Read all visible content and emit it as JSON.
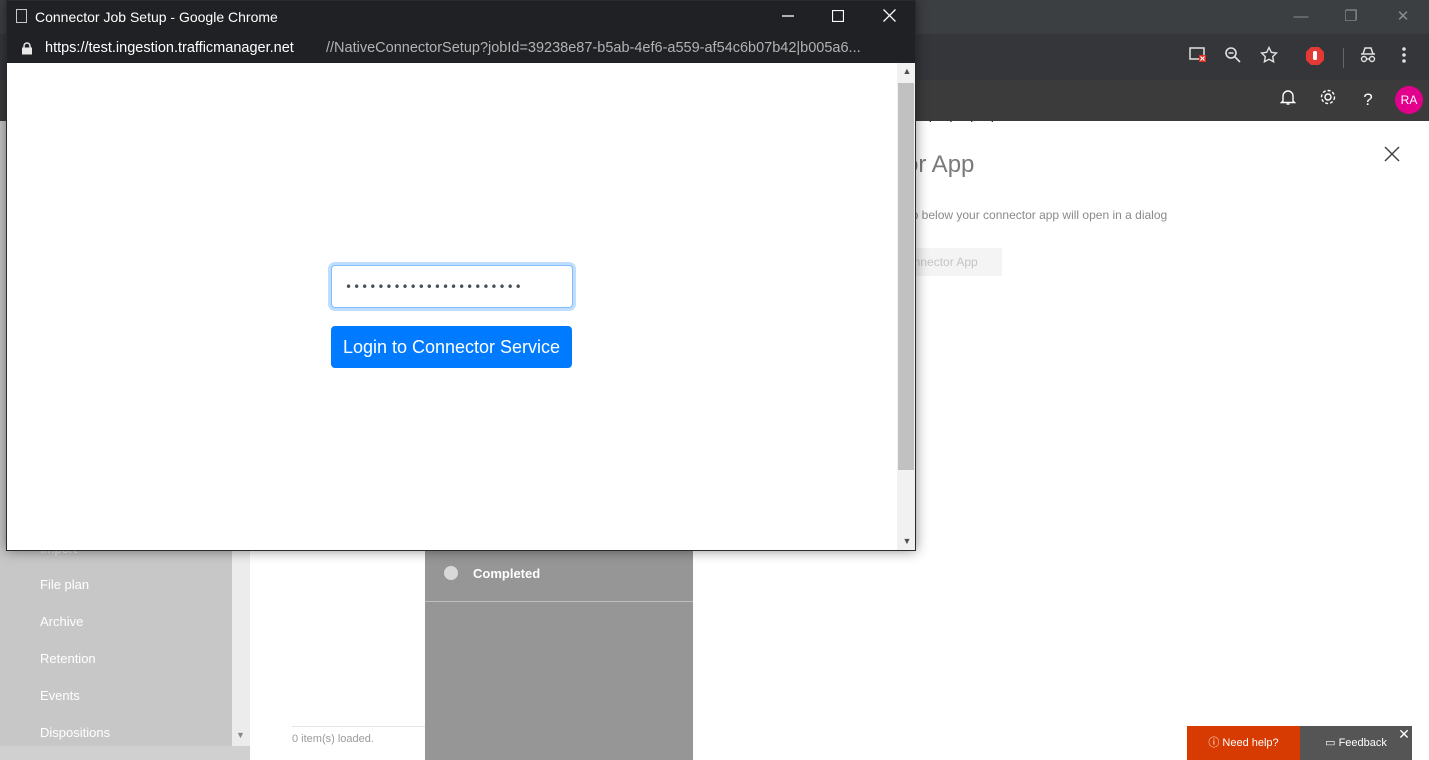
{
  "background": {
    "window_controls": [
      "—",
      "❐",
      "✕"
    ],
    "toolbar_icons": [
      "cast-blocked-icon",
      "zoom-icon",
      "star-icon",
      "adblock-icon",
      "incognito-icon",
      "menu-icon"
    ],
    "app_icons": [
      "bell-icon",
      "gear-icon",
      "help-icon"
    ],
    "avatar_initials": "RA",
    "left_nav": {
      "partial_item": "Import",
      "items": [
        "File plan",
        "Archive",
        "Retention",
        "Events",
        "Dispositions"
      ]
    },
    "list_footer": "0 item(s) loaded.",
    "steps": {
      "completed_label": "Completed"
    },
    "main": {
      "heading": "or App",
      "description": "op below your connector app will open in a dialog",
      "button_label": "onnector App"
    },
    "help_label": "Need help?",
    "feedback_label": "Feedback"
  },
  "popup": {
    "title": "Connector Job Setup - Google Chrome",
    "url_host": "https://test.ingestion.trafficmanager.net",
    "url_path": "//NativeConnectorSetup?jobId=39238e87-b5ab-4ef6-a559-af54c6b07b42|b005a6...",
    "password_value": "••••••••••••••••••••••",
    "login_button": "Login to Connector Service"
  },
  "colors": {
    "primary_button": "#007bff",
    "help_button": "#d83b01",
    "avatar": "#e3008c"
  }
}
